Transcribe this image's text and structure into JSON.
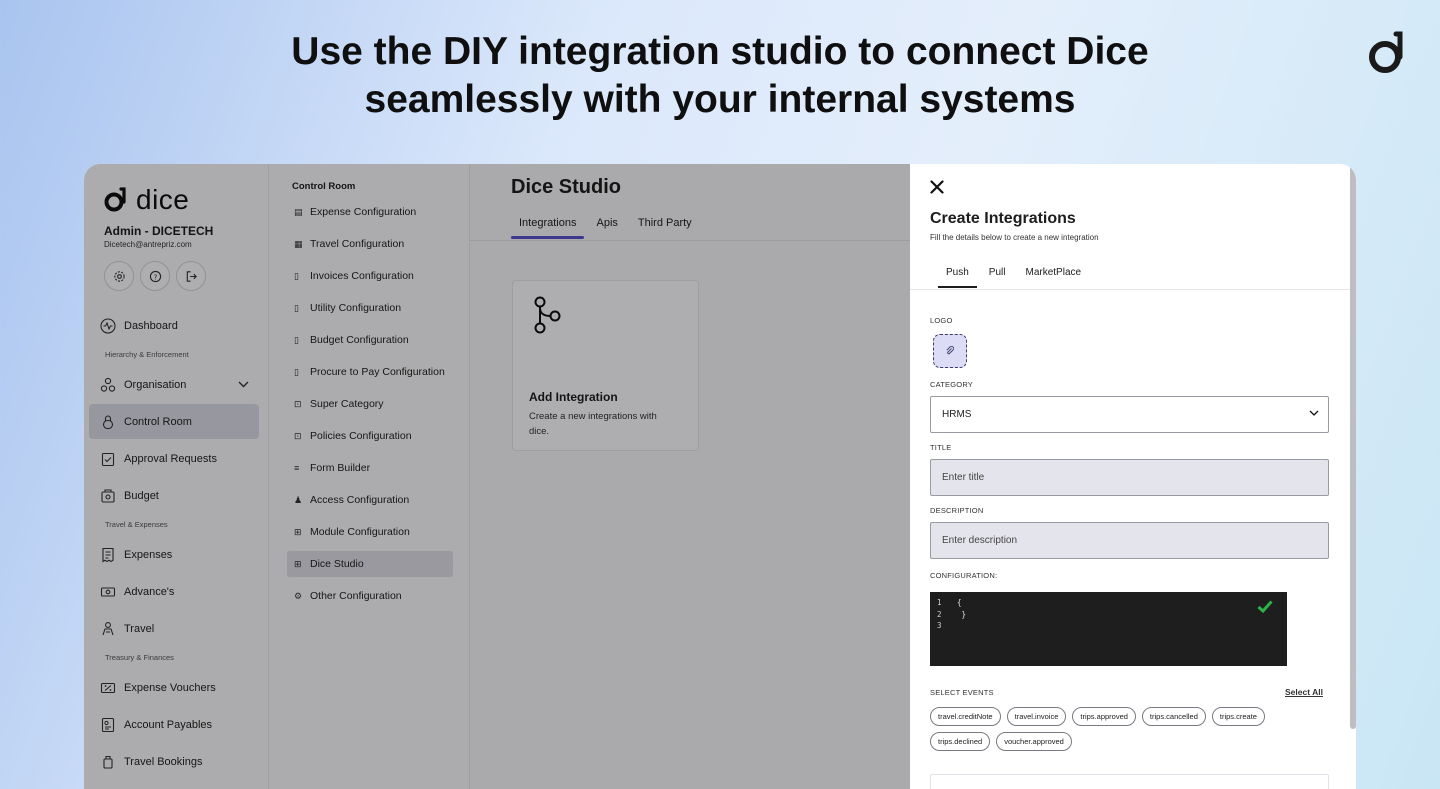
{
  "headline": {
    "line1": "Use the DIY integration studio to connect Dice",
    "line2": "seamlessly with your internal systems"
  },
  "sidebar": {
    "logo_text": "dice",
    "admin_name": "Admin - DICETECH",
    "admin_email": "Dicetech@antrepriz.com",
    "items": [
      {
        "label": "Dashboard"
      },
      {
        "group": "Hierarchy & Enforcement"
      },
      {
        "label": "Organisation"
      },
      {
        "label": "Control Room"
      },
      {
        "label": "Approval Requests"
      },
      {
        "label": "Budget"
      },
      {
        "group": "Travel & Expenses"
      },
      {
        "label": "Expenses"
      },
      {
        "label": "Advance's"
      },
      {
        "label": "Travel"
      },
      {
        "group": "Treasury & Finances"
      },
      {
        "label": "Expense Vouchers"
      },
      {
        "label": "Account Payables"
      },
      {
        "label": "Travel Bookings"
      }
    ]
  },
  "submenu": {
    "title": "Control Room",
    "items": [
      {
        "label": "Expense Configuration",
        "icon": "▤"
      },
      {
        "label": "Travel Configuration",
        "icon": "▦"
      },
      {
        "label": "Invoices Configuration",
        "icon": "▯"
      },
      {
        "label": "Utility Configuration",
        "icon": "▯"
      },
      {
        "label": "Budget Configuration",
        "icon": "▯"
      },
      {
        "label": "Procure to Pay Configuration",
        "icon": "▯"
      },
      {
        "label": "Super Category",
        "icon": "⊡"
      },
      {
        "label": "Policies Configuration",
        "icon": "⊡"
      },
      {
        "label": "Form Builder",
        "icon": "≡"
      },
      {
        "label": "Access Configuration",
        "icon": "♟"
      },
      {
        "label": "Module Configuration",
        "icon": "⊞"
      },
      {
        "label": "Dice Studio",
        "icon": "⊞"
      },
      {
        "label": "Other Configuration",
        "icon": "⚙"
      }
    ]
  },
  "main": {
    "title": "Dice Studio",
    "tabs": [
      "Integrations",
      "Apis",
      "Third Party"
    ],
    "card": {
      "title": "Add Integration",
      "description": "Create a new integrations with dice."
    }
  },
  "panel": {
    "title": "Create Integrations",
    "subtitle": "Fill the details below to create a new integration",
    "tabs": [
      "Push",
      "Pull",
      "MarketPlace"
    ],
    "logo_label": "LOGO",
    "category_label": "CATEGORY",
    "category_value": "HRMS",
    "title_label": "TITLE",
    "title_placeholder": "Enter title",
    "description_label": "DESCRIPTION",
    "description_placeholder": "Enter description",
    "configuration_label": "CONFIGURATION:",
    "code_lines": [
      {
        "num": "1",
        "text": "{"
      },
      {
        "num": "2",
        "text": " }"
      },
      {
        "num": "3",
        "text": ""
      }
    ],
    "events_label": "SELECT EVENTS",
    "select_all": "Select All",
    "events": [
      "travel.creditNote",
      "travel.invoice",
      "trips.approved",
      "trips.cancelled",
      "trips.create",
      "trips.declined",
      "voucher.approved"
    ]
  },
  "colors": {
    "accent": "#5a4fcf",
    "code_bg": "#1e1e1e",
    "check": "#2bb34a"
  }
}
